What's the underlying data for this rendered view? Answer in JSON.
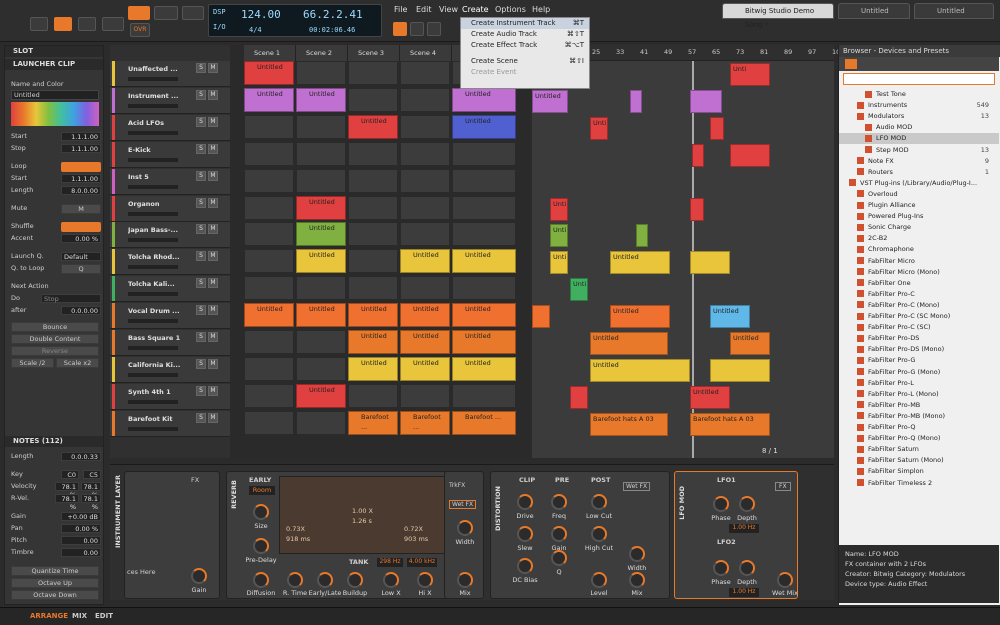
{
  "transport": {
    "tempo": "124.00",
    "time_sig": "4/4",
    "position": "66.2.2.41",
    "time": "00:02:06.46",
    "dsp": "DSP",
    "io": "I/O",
    "ovr": "OVR"
  },
  "menu": {
    "items": [
      "File",
      "Edit",
      "View",
      "Create",
      "Options",
      "Help"
    ]
  },
  "create_menu": [
    {
      "label": "Create Instrument Track",
      "shortcut": "⌘T",
      "state": "hl"
    },
    {
      "label": "Create Audio Track",
      "shortcut": "⌘⇧T",
      "state": ""
    },
    {
      "label": "Create Effect Track",
      "shortcut": "⌘⌥T",
      "state": ""
    },
    {
      "label": "Create Scene",
      "shortcut": "⌘⇧I",
      "state": ""
    },
    {
      "label": "Create Event",
      "shortcut": "",
      "state": "dis"
    }
  ],
  "doc_tabs": [
    "Bitwig Studio Demo Song *",
    "Untitled",
    "Untitled"
  ],
  "inspector": {
    "slot": "SLOT",
    "launcher_clip": "LAUNCHER CLIP",
    "name_color": "Name and Color",
    "clip_name": "Untitled",
    "start_l": "Start",
    "start_v": "1.1.1.00",
    "stop_l": "Stop",
    "stop_v": "1.1.1.00",
    "loop_l": "Loop",
    "loop_start_l": "Start",
    "loop_start_v": "1.1.1.00",
    "length_l": "Length",
    "length_v": "8.0.0.00",
    "mute_l": "Mute",
    "mute_v": "M",
    "shuffle_l": "Shuffle",
    "accent_l": "Accent",
    "accent_v": "0.00 %",
    "launch_q_l": "Launch Q.",
    "launch_q_v": "Default",
    "q_loop_l": "Q. to Loop",
    "q_loop_v": "Q",
    "next_action": "Next Action",
    "do_l": "Do",
    "do_v": "Stop",
    "after_l": "after",
    "after_v": "0.0.0.00",
    "bounce": "Bounce",
    "double": "Double Content",
    "reverse": "Reverse",
    "scale_half": "Scale /2",
    "scale_x2": "Scale x2",
    "notes": "NOTES (112)",
    "n_length_l": "Length",
    "n_length_v": "0.0.0.33",
    "key_l": "Key",
    "key_v1": "C0",
    "key_v2": "C5",
    "vel_l": "Velocity",
    "vel_v1": "78.1 %",
    "vel_v2": "78.1 %",
    "rvel_l": "R-Vel.",
    "rvel_v1": "78.1 %",
    "rvel_v2": "78.1 %",
    "gain_l": "Gain",
    "gain_v": "+0.00 dB",
    "pan_l": "Pan",
    "pan_v": "0.00 %",
    "pitch_l": "Pitch",
    "pitch_v": "0.00",
    "timbre_l": "Timbre",
    "timbre_v": "0.00",
    "qt": "Quantize Time",
    "oct_up": "Octave Up",
    "oct_down": "Octave Down"
  },
  "tracks": [
    "Unaffected ...",
    "Instrument ...",
    "Acid LFOs",
    "E-Kick",
    "Inst 5",
    "Organon",
    "Japan Bass-...",
    "Tolcha Rhod...",
    "Tolcha Kali...",
    "Vocal Drum ...",
    "Bass Square 1",
    "California Ki...",
    "Synth 4th 1",
    "Barefoot Kit"
  ],
  "scenes": [
    "Scene 1",
    "Scene 2",
    "Scene 3",
    "Scene 4"
  ],
  "clip_label": "Untitled",
  "barefoot_clip": "Barefoot ...",
  "ruler": [
    "25",
    "33",
    "41",
    "49",
    "57",
    "65",
    "73",
    "81",
    "89",
    "97",
    "105",
    "113"
  ],
  "arr_clips": {
    "untitled": "Untitled",
    "unti": "Unti",
    "barefoot": "Barefoot hats A 03",
    "page": "8 / 1"
  },
  "browser": {
    "title": "Browser - Devices and Presets",
    "items": [
      {
        "label": "Test Tone",
        "count": "",
        "indent": 2
      },
      {
        "label": "Instruments",
        "count": "549",
        "indent": 1
      },
      {
        "label": "Modulators",
        "count": "13",
        "indent": 1
      },
      {
        "label": "Audio MOD",
        "count": "",
        "indent": 2
      },
      {
        "label": "LFO MOD",
        "count": "",
        "indent": 2,
        "sel": true
      },
      {
        "label": "Step MOD",
        "count": "13",
        "indent": 2
      },
      {
        "label": "Note FX",
        "count": "9",
        "indent": 1
      },
      {
        "label": "Routers",
        "count": "1",
        "indent": 1
      },
      {
        "label": "VST Plug-ins (/Library/Audio/Plug-I...",
        "count": "",
        "indent": 0
      },
      {
        "label": "Overloud",
        "count": "",
        "indent": 1
      },
      {
        "label": "Plugin Alliance",
        "count": "",
        "indent": 1
      },
      {
        "label": "Powered Plug-Ins",
        "count": "",
        "indent": 1
      },
      {
        "label": "Sonic Charge",
        "count": "",
        "indent": 1
      },
      {
        "label": "2C-B2",
        "count": "",
        "indent": 1
      },
      {
        "label": "Chromaphone",
        "count": "",
        "indent": 1
      },
      {
        "label": "FabFilter Micro",
        "count": "",
        "indent": 1
      },
      {
        "label": "FabFilter Micro (Mono)",
        "count": "",
        "indent": 1
      },
      {
        "label": "FabFilter One",
        "count": "",
        "indent": 1
      },
      {
        "label": "FabFilter Pro-C",
        "count": "",
        "indent": 1
      },
      {
        "label": "FabFilter Pro-C (Mono)",
        "count": "",
        "indent": 1
      },
      {
        "label": "FabFilter Pro-C (SC Mono)",
        "count": "",
        "indent": 1
      },
      {
        "label": "FabFilter Pro-C (SC)",
        "count": "",
        "indent": 1
      },
      {
        "label": "FabFilter Pro-DS",
        "count": "",
        "indent": 1
      },
      {
        "label": "FabFilter Pro-DS (Mono)",
        "count": "",
        "indent": 1
      },
      {
        "label": "FabFilter Pro-G",
        "count": "",
        "indent": 1
      },
      {
        "label": "FabFilter Pro-G (Mono)",
        "count": "",
        "indent": 1
      },
      {
        "label": "FabFilter Pro-L",
        "count": "",
        "indent": 1
      },
      {
        "label": "FabFilter Pro-L (Mono)",
        "count": "",
        "indent": 1
      },
      {
        "label": "FabFilter Pro-MB",
        "count": "",
        "indent": 1
      },
      {
        "label": "FabFilter Pro-MB (Mono)",
        "count": "",
        "indent": 1
      },
      {
        "label": "FabFilter Pro-Q",
        "count": "",
        "indent": 1
      },
      {
        "label": "FabFilter Pro-Q (Mono)",
        "count": "",
        "indent": 1
      },
      {
        "label": "FabFilter Saturn",
        "count": "",
        "indent": 1
      },
      {
        "label": "FabFilter Saturn (Mono)",
        "count": "",
        "indent": 1
      },
      {
        "label": "FabFilter Simplon",
        "count": "",
        "indent": 1
      },
      {
        "label": "FabFilter Timeless 2",
        "count": "",
        "indent": 1
      }
    ],
    "info_name": "Name: LFO MOD",
    "info_desc": "FX container with 2 LFOs",
    "info_creator": "Creator: Bitwig  Category: Modulators",
    "info_type": "Device type: Audio Effect"
  },
  "devices": {
    "layer": "INSTRUMENT LAYER",
    "fx": "FX",
    "places": "ces Here",
    "gain": "Gain",
    "reverb": "REVERB",
    "early": "EARLY",
    "room": "Room",
    "size": "Size",
    "predelay": "Pre-Delay",
    "diffusion": "Diffusion",
    "rtime": "R. Time",
    "early_late": "Early/Late",
    "buildup": "Buildup",
    "tank": "TANK",
    "lowx": "Low X",
    "hix": "Hi X",
    "hz1": "298 Hz",
    "hz2": "4.00 kHz",
    "v1": "1.00 X",
    "v2": "1.26 s",
    "v3": "0.73X",
    "v4": "918 ms",
    "v5": "0.72X",
    "v6": "903 ms",
    "trk": "TrkFX",
    "wetfx": "Wet FX",
    "width": "Width",
    "mix": "Mix",
    "distortion": "DISTORTION",
    "clip": "CLIP",
    "drive": "Drive",
    "slew": "Slew",
    "dcbias": "DC Bias",
    "pre": "PRE",
    "freq": "Freq",
    "dgain": "Gain",
    "q": "Q",
    "post": "POST",
    "lowcut": "Low Cut",
    "highcut": "High Cut",
    "level": "Level",
    "wetfx2": "Wet FX",
    "width2": "Width",
    "mix2": "Mix",
    "lfomod": "LFO MOD",
    "lfo1": "LFO1",
    "lfo2": "LFO2",
    "phase": "Phase",
    "depth": "Depth",
    "hz": "1.00 Hz",
    "wetmix": "Wet Mix",
    "fx2": "FX"
  },
  "status": {
    "arrange": "ARRANGE",
    "mix": "MIX",
    "edit": "EDIT"
  }
}
